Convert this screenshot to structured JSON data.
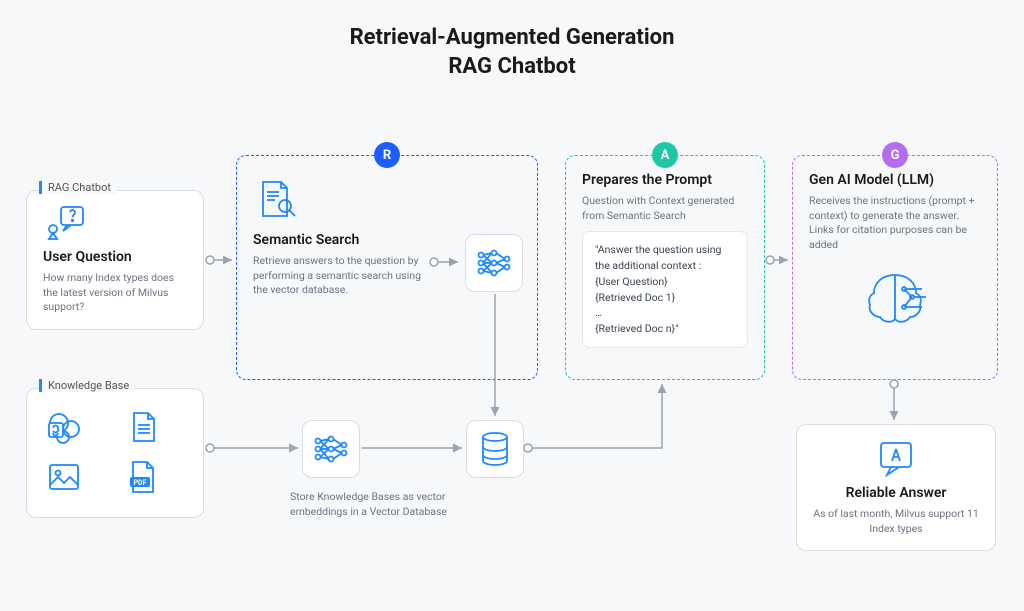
{
  "title_line1": "Retrieval-Augmented Generation",
  "title_line2": "RAG Chatbot",
  "user_question": {
    "label": "RAG Chatbot",
    "title": "User Question",
    "desc": "How many Index types does the latest version of Milvus support?"
  },
  "knowledge_base": {
    "label": "Knowledge Base",
    "subtext": "Store Knowledge Bases as vector embeddings in a Vector Database"
  },
  "r": {
    "badge": "R",
    "title": "Semantic Search",
    "desc": "Retrieve answers to the question by performing a semantic search using the vector database."
  },
  "a": {
    "badge": "A",
    "title": "Prepares the Prompt",
    "desc": "Question with Context generated from Semantic Search",
    "prompt_l1": "\"Answer the question using the additional context :",
    "prompt_l2": "{User Question}",
    "prompt_l3": "{Retrieved Doc 1}",
    "prompt_l4": "…",
    "prompt_l5": "{Retrieved Doc n}\""
  },
  "g": {
    "badge": "G",
    "title": "Gen AI Model (LLM)",
    "desc": "Receives the instructions (prompt + context) to generate the answer. Links for citation purposes can be added"
  },
  "answer": {
    "title": "Reliable Answer",
    "desc": "As of last month, Milvus support 11 Index types"
  }
}
